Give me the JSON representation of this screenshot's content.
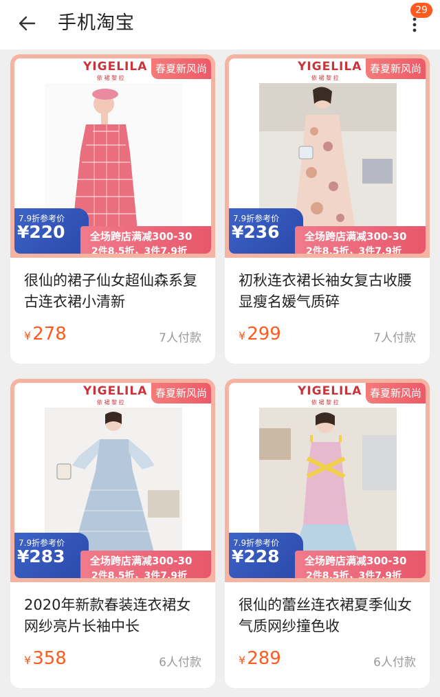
{
  "header": {
    "title": "手机淘宝",
    "badge_count": "29",
    "back_icon": "arrow-left-icon",
    "more_icon": "more-vertical-icon"
  },
  "products": [
    {
      "brand": "YIGELILA",
      "brand_sub": "依 裙 黎 拉",
      "season_tag": "春夏新风尚",
      "discount_label": "7.9折参考价",
      "discount_price": "¥220",
      "promo_line1": "全场跨店满减300-30",
      "promo_line2": "2件8.5折，3件7.9折",
      "title": "很仙的裙子仙女超仙森系复古连衣裙小清新",
      "price_symbol": "¥",
      "price": "278",
      "sold": "7人付款",
      "accent": "#e96f7f"
    },
    {
      "brand": "YIGELILA",
      "brand_sub": "依 裙 黎 拉",
      "season_tag": "春夏新风尚",
      "discount_label": "7.9折参考价",
      "discount_price": "¥236",
      "promo_line1": "全场跨店满减300-30",
      "promo_line2": "2件8.5折，3件7.9折",
      "title": "初秋连衣裙长袖女复古收腰显瘦名媛气质碎",
      "price_symbol": "¥",
      "price": "299",
      "sold": "7人付款",
      "accent": "#d9a48b"
    },
    {
      "brand": "YIGELILA",
      "brand_sub": "依 裙 黎 拉",
      "season_tag": "春夏新风尚",
      "discount_label": "7.9折参考价",
      "discount_price": "¥283",
      "promo_line1": "全场跨店满减300-30",
      "promo_line2": "2件8.5折，3件7.9折",
      "title": "2020年新款春装连衣裙女网纱亮片长袖中长",
      "price_symbol": "¥",
      "price": "358",
      "sold": "6人付款",
      "accent": "#a9bfd6"
    },
    {
      "brand": "YIGELILA",
      "brand_sub": "依 裙 黎 拉",
      "season_tag": "春夏新风尚",
      "discount_label": "7.9折参考价",
      "discount_price": "¥228",
      "promo_line1": "全场跨店满减300-30",
      "promo_line2": "2件8.5折，3件7.9折",
      "title": "很仙的蕾丝连衣裙夏季仙女气质网纱撞色收",
      "price_symbol": "¥",
      "price": "289",
      "sold": "6人付款",
      "accent": "#e7b9cf"
    }
  ]
}
